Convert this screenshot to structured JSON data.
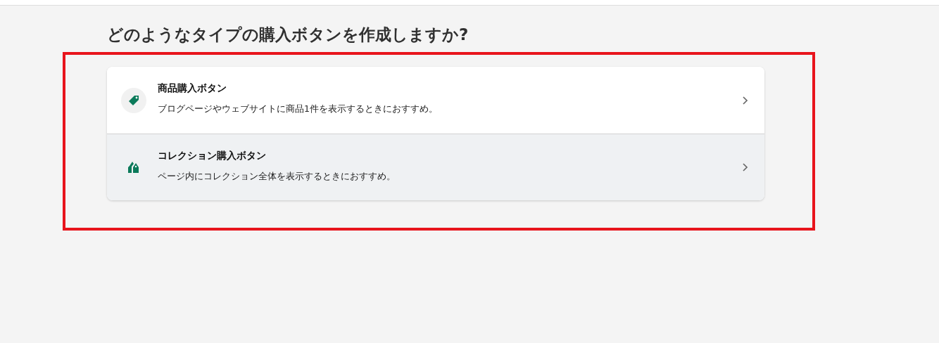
{
  "heading": "どのようなタイプの購入ボタンを作成しますか?",
  "options": [
    {
      "kind": "product",
      "title": "商品購入ボタン",
      "description": "ブログページやウェブサイトに商品1件を表示するときにおすすめ。",
      "highlighted": false
    },
    {
      "kind": "collection",
      "title": "コレクション購入ボタン",
      "description": "ページ内にコレクション全体を表示するときにおすすめ。",
      "highlighted": true
    }
  ]
}
